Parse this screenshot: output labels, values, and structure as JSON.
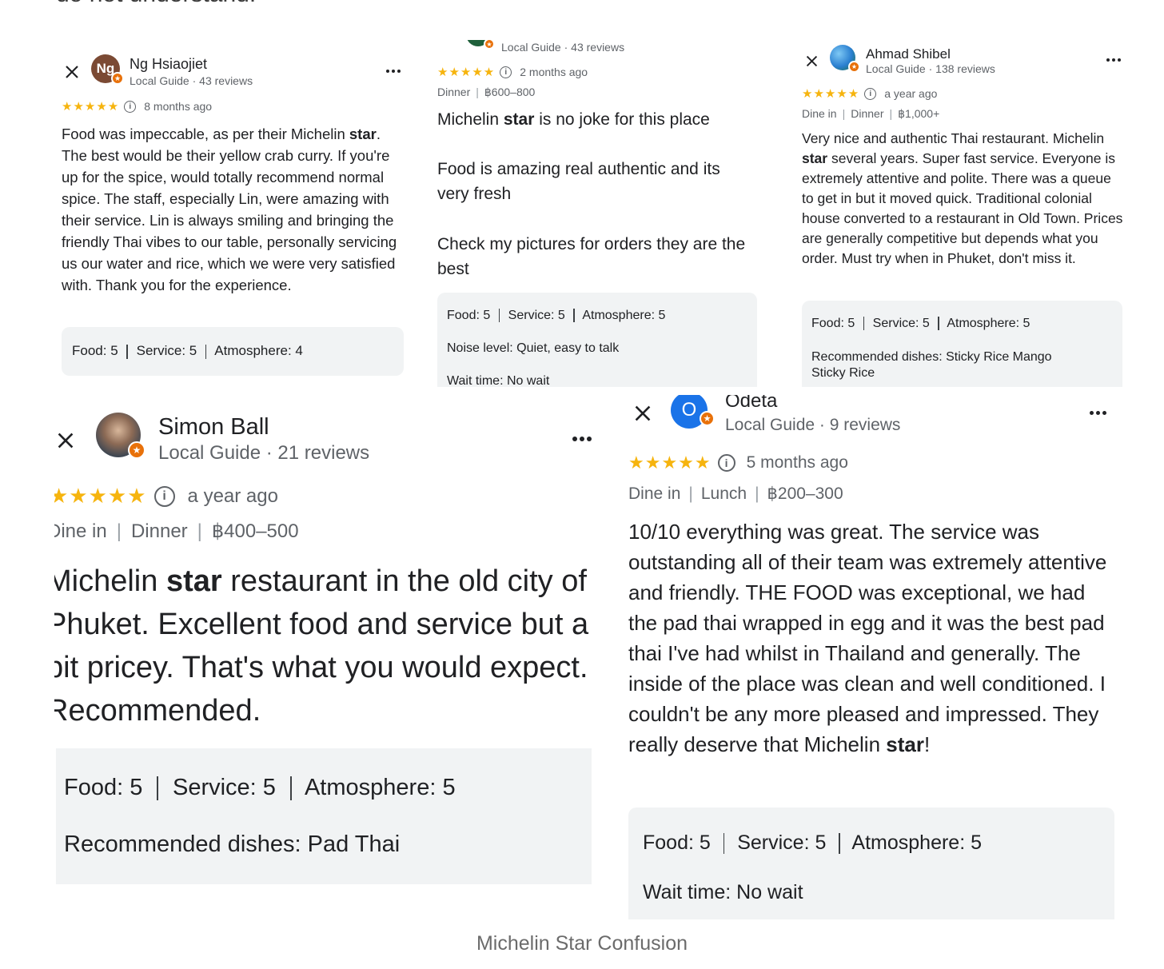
{
  "top_text": "do not understand.",
  "caption": "Michelin Star Confusion",
  "colors": {
    "star": "#f6b40e",
    "badge": "#e8710a",
    "box_bg": "#f1f3f4",
    "avatar_ng": "#7b4a34",
    "avatar_o": "#1a73e8"
  },
  "review1": {
    "avatar_text": "Ng",
    "name": "Ng Hsiaojiet",
    "meta": "Local Guide · 43 reviews",
    "stars": "★★★★★",
    "time": "8 months ago",
    "text_a": "Food was impeccable, as per their Michelin ",
    "text_b": "star",
    "text_c": ". The best would be their yellow crab curry. If you're up for the spice, would totally recommend normal spice. The staff, especially Lin, were amazing with their service. Lin is always smiling and bringing the friendly Thai vibes to our table, personally servicing us our water and rice, which we were very satisfied with. Thank you for the experience.",
    "food_label": "Food:",
    "food_value": " 5",
    "service_label": "Service:",
    "service_value": " 5",
    "atmosphere_label": "Atmosphere:",
    "atmosphere_value": " 4"
  },
  "review2": {
    "meta": "Local Guide · 43 reviews",
    "stars": "★★★★★",
    "time": "2 months ago",
    "tag1": "Dinner",
    "tag2": "฿600–800",
    "p1_a": "Michelin ",
    "p1_b": "star",
    "p1_c": " is no joke for this place",
    "p2": "Food is amazing real authentic and its very fresh",
    "p3": "Check my pictures for orders they are the best",
    "food_label": "Food:",
    "food_value": " 5",
    "service_label": "Service:",
    "service_value": " 5",
    "atmosphere_label": "Atmosphere:",
    "atmosphere_value": " 5",
    "noise_label": "Noise level:",
    "noise_value": " Quiet, easy to talk",
    "wait_label": "Wait time:",
    "wait_value": " No wait"
  },
  "review3": {
    "name": "Ahmad Shibel",
    "meta": "Local Guide · 138 reviews",
    "stars": "★★★★★",
    "time": "a year ago",
    "tag1": "Dine in",
    "tag2": "Dinner",
    "tag3": "฿1,000+",
    "text_a": "Very nice and authentic Thai restaurant. Michelin ",
    "text_b": "star",
    "text_c": " several years. Super fast service. Everyone is extremely attentive and polite. There was a queue to get in but it moved quick. Traditional colonial house converted to a restaurant in Old Town. Prices are generally competitive but depends what you order. Must try when in Phuket, don't miss it.",
    "food_label": "Food:",
    "food_value": " 5",
    "service_label": "Service:",
    "service_value": " 5",
    "atmosphere_label": "Atmosphere:",
    "atmosphere_value": " 5",
    "dishes_label": "Recommended dishes:",
    "dishes_value": " Sticky Rice Mango Sticky Rice"
  },
  "review4": {
    "name": "Simon Ball",
    "meta": "Local Guide · 21 reviews",
    "stars": "★★★★★",
    "time": "a year ago",
    "tag1": "Dine in",
    "tag2": "Dinner",
    "tag3": "฿400–500",
    "line1_a": "Michelin ",
    "line1_b": "star",
    "line1_c": " restaurant in the old city of",
    "line2": "Phuket. Excellent food and service but a",
    "line3": "bit pricey. That's what you would expect.",
    "line4": "Recommended.",
    "food_label": "Food:",
    "food_value": " 5",
    "service_label": "Service:",
    "service_value": " 5",
    "atmosphere_label": "Atmosphere:",
    "atmosphere_value": " 5",
    "dishes_label": "Recommended dishes:",
    "dishes_value": " Pad Thai"
  },
  "review5": {
    "avatar_text": "O",
    "name": "Odeta",
    "meta": "Local Guide · 9 reviews",
    "stars": "★★★★★",
    "time": "5 months ago",
    "tag1": "Dine in",
    "tag2": "Lunch",
    "tag3": "฿200–300",
    "text_a": "10/10 everything was great. The service was outstanding all of their team was extremely attentive and friendly. THE FOOD was exceptional, we had the pad thai wrapped in egg and it was the best pad thai I've had whilst in Thailand and generally. The inside of the place was clean and well conditioned. I couldn't be any more pleased and impressed. They really deserve that Michelin ",
    "text_b": "star",
    "text_c": "!",
    "food_label": "Food:",
    "food_value": " 5",
    "service_label": "Service:",
    "service_value": " 5",
    "atmosphere_label": "Atmosphere:",
    "atmosphere_value": " 5",
    "wait_label": "Wait time:",
    "wait_value": " No wait"
  }
}
